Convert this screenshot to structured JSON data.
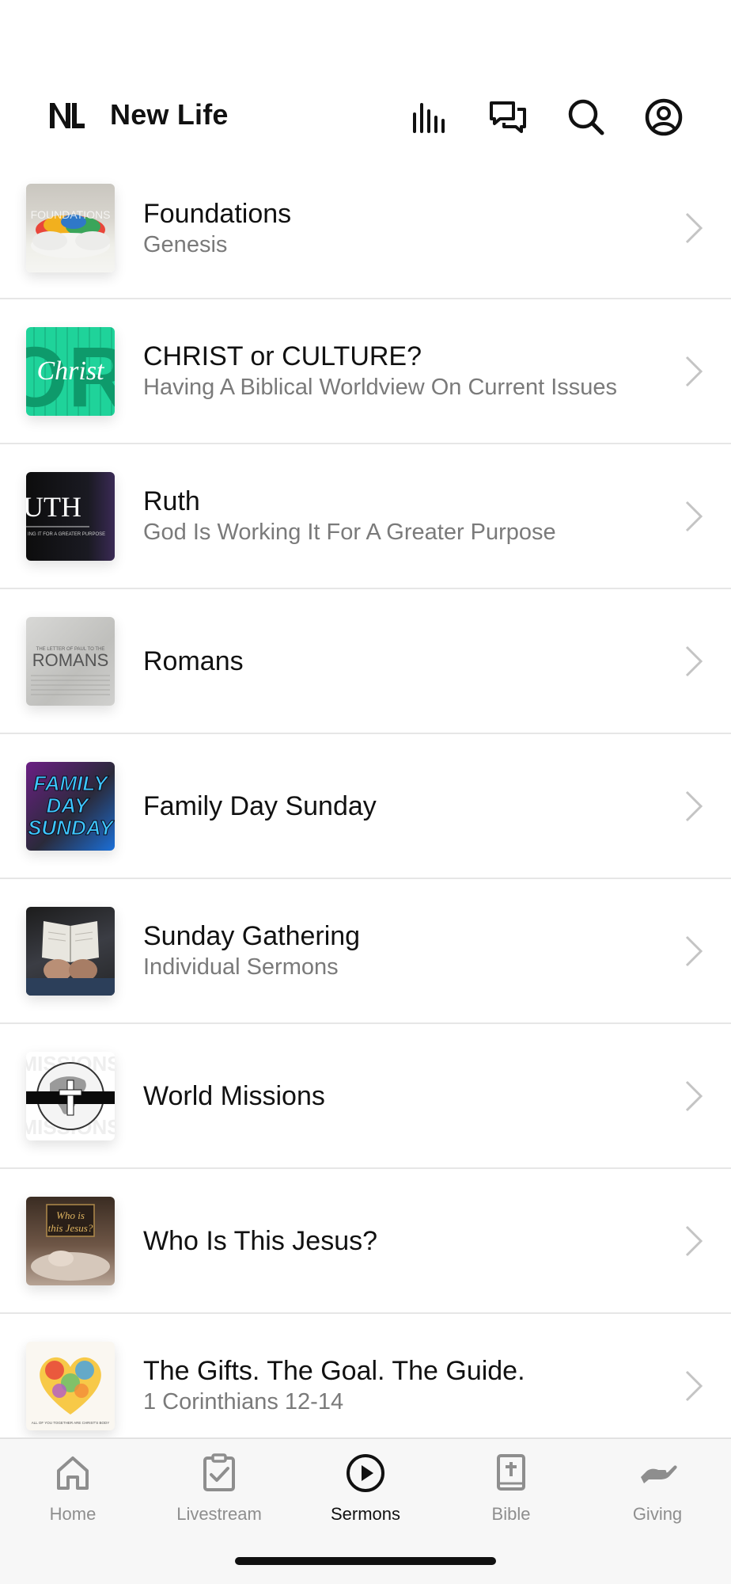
{
  "app": {
    "title": "New Life",
    "logo_text": "NL"
  },
  "header": {
    "icons": [
      "bars-chart-icon",
      "chat-icon",
      "search-icon",
      "profile-icon"
    ]
  },
  "series": [
    {
      "title": "Foundations",
      "subtitle": "Genesis",
      "thumb_text": "FOUNDATIONS"
    },
    {
      "title": "CHRIST or CULTURE?",
      "subtitle": "Having A Biblical Worldview On Current Issues",
      "thumb_text": "Christ"
    },
    {
      "title": "Ruth",
      "subtitle": "God Is Working It For A Greater Purpose",
      "thumb_text": "UTH"
    },
    {
      "title": "Romans",
      "subtitle": "",
      "thumb_text": "ROMANS"
    },
    {
      "title": "Family Day Sunday",
      "subtitle": "",
      "thumb_text": "FAMILY DAY SUNDAY"
    },
    {
      "title": "Sunday Gathering",
      "subtitle": "Individual Sermons",
      "thumb_text": ""
    },
    {
      "title": "World Missions",
      "subtitle": "",
      "thumb_text": "MISSIONS"
    },
    {
      "title": "Who Is This Jesus?",
      "subtitle": "",
      "thumb_text": "Who is this Jesus?"
    },
    {
      "title": "The Gifts. The Goal. The Guide.",
      "subtitle": "1 Corinthians 12-14",
      "thumb_text": ""
    }
  ],
  "tabs": [
    {
      "label": "Home",
      "icon": "home-icon",
      "active": false
    },
    {
      "label": "Livestream",
      "icon": "clipboard-check-icon",
      "active": false
    },
    {
      "label": "Sermons",
      "icon": "play-circle-icon",
      "active": true
    },
    {
      "label": "Bible",
      "icon": "bible-icon",
      "active": false
    },
    {
      "label": "Giving",
      "icon": "giving-hand-icon",
      "active": false
    }
  ],
  "colors": {
    "active": "#111111",
    "inactive": "#8e8e8e",
    "accent_green": "#1fd39a"
  }
}
